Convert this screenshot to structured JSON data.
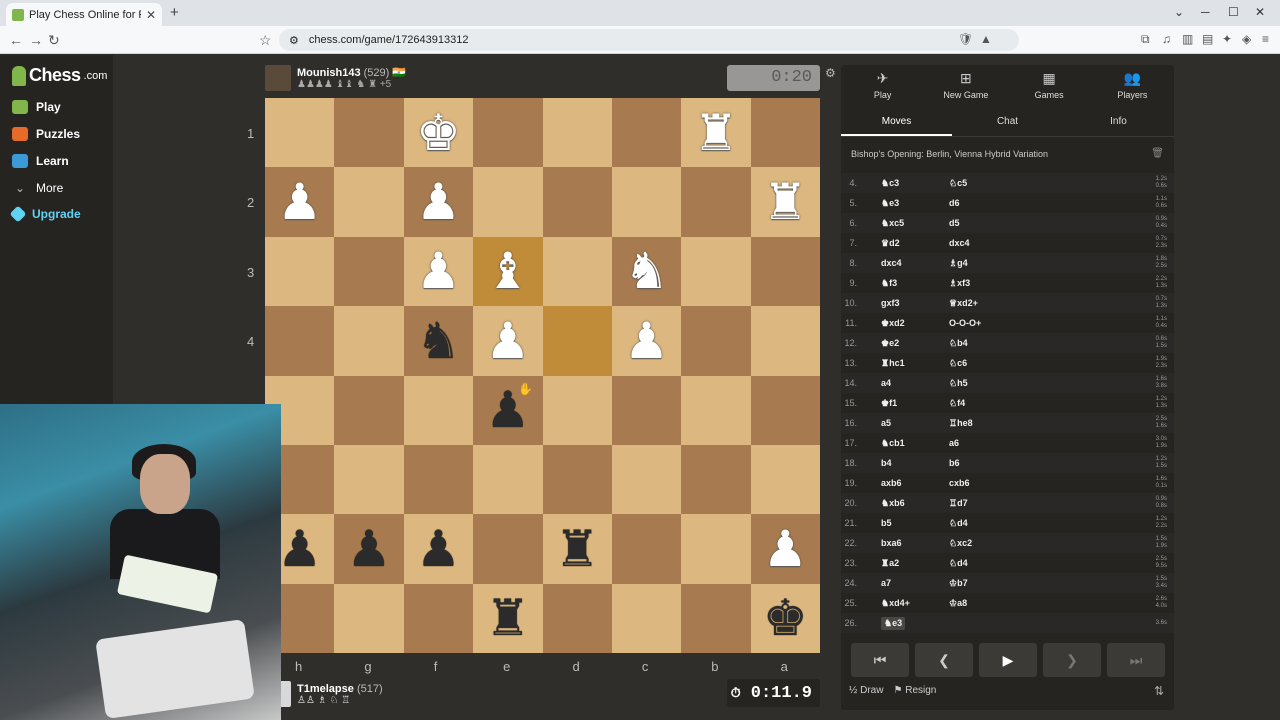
{
  "browser": {
    "tab_title": "Play Chess Online for FREE - ...",
    "tab_close": "✕",
    "new_tab": "+",
    "url": "chess.com/game/172643913312",
    "back": "←",
    "forward": "→",
    "reload": "↻",
    "win_min": "─",
    "win_max": "☐",
    "win_close": "✕",
    "win_down": "⌄"
  },
  "sidebar": {
    "logo": "Chess",
    "logo_suffix": ".com",
    "items": [
      {
        "label": "Play",
        "color": "#81b64c"
      },
      {
        "label": "Puzzles",
        "color": "#e66b28"
      },
      {
        "label": "Learn",
        "color": "#3d9ad8"
      },
      {
        "label": "More",
        "color": "#bbb"
      },
      {
        "label": "Upgrade",
        "color": "#5fd3f3"
      }
    ]
  },
  "top_player": {
    "name": "Mounish143",
    "rating": "(529)",
    "flag": "🇮🇳",
    "captured": "♟♟♟♟ ♝♝ ♞ ♜ +5",
    "clock": "0:20"
  },
  "bottom_player": {
    "name": "T1melapse",
    "rating": "(517)",
    "captured": "♙♙ ♗ ♘ ♖",
    "clock": "0:11.9",
    "clock_icon": "⏱"
  },
  "board": {
    "ranks": [
      "1",
      "2",
      "3",
      "4",
      "5",
      "6",
      "7",
      "8"
    ],
    "files": [
      "h",
      "g",
      "f",
      "e",
      "d",
      "c",
      "b",
      "a"
    ],
    "rows": [
      [
        "",
        "",
        "wK",
        "",
        "",
        "",
        "wR",
        ""
      ],
      [
        "wP",
        "",
        "wP",
        "",
        "",
        "",
        "",
        "wR"
      ],
      [
        "",
        "",
        "wP",
        "wB",
        "",
        "wN",
        "",
        ""
      ],
      [
        "",
        "",
        "bN",
        "wP",
        "",
        "wP",
        "",
        ""
      ],
      [
        "",
        "",
        "",
        "bP",
        "",
        "",
        "",
        ""
      ],
      [
        "",
        "",
        "",
        "",
        "",
        "",
        "",
        ""
      ],
      [
        "bP",
        "bP",
        "bP",
        "",
        "bR",
        "",
        "",
        "wP"
      ],
      [
        "",
        "",
        "",
        "bR",
        "",
        "",
        "",
        "bK"
      ]
    ],
    "highlights": [
      [
        2,
        3
      ],
      [
        3,
        4
      ]
    ],
    "light_color": "#dcb77f",
    "dark_color": "#a77b4f"
  },
  "panel": {
    "tabs": [
      {
        "label": "Play",
        "icon": "✈"
      },
      {
        "label": "New Game",
        "icon": "⊞"
      },
      {
        "label": "Games",
        "icon": "▦"
      },
      {
        "label": "Players",
        "icon": "👥"
      }
    ],
    "subtabs": [
      "Moves",
      "Chat",
      "Info"
    ],
    "opening": "Bishop's Opening: Berlin, Vienna Hybrid Variation",
    "moves": [
      {
        "n": "4.",
        "w": "♞c3",
        "b": "♘c5",
        "t1": "1.2s",
        "t2": "0.6s"
      },
      {
        "n": "5.",
        "w": "♞e3",
        "b": "d6",
        "t1": "1.1s",
        "t2": "0.6s"
      },
      {
        "n": "6.",
        "w": "♞xc5",
        "b": "d5",
        "t1": "0.9s",
        "t2": "0.4s"
      },
      {
        "n": "7.",
        "w": "♛d2",
        "b": "dxc4",
        "t1": "0.7s",
        "t2": "2.3s"
      },
      {
        "n": "8.",
        "w": "dxc4",
        "b": "♗g4",
        "t1": "1.8s",
        "t2": "2.5s"
      },
      {
        "n": "9.",
        "w": "♞f3",
        "b": "♗xf3",
        "t1": "2.2s",
        "t2": "1.3s"
      },
      {
        "n": "10.",
        "w": "gxf3",
        "b": "♕xd2+",
        "t1": "0.7s",
        "t2": "1.3s"
      },
      {
        "n": "11.",
        "w": "♚xd2",
        "b": "O-O-O+",
        "t1": "1.1s",
        "t2": "0.4s"
      },
      {
        "n": "12.",
        "w": "♚e2",
        "b": "♘b4",
        "t1": "0.6s",
        "t2": "1.5s"
      },
      {
        "n": "13.",
        "w": "♜hc1",
        "b": "♘c6",
        "t1": "1.9s",
        "t2": "2.3s"
      },
      {
        "n": "14.",
        "w": "a4",
        "b": "♘h5",
        "t1": "1.6s",
        "t2": "3.8s"
      },
      {
        "n": "15.",
        "w": "♚f1",
        "b": "♘f4",
        "t1": "1.2s",
        "t2": "1.3s"
      },
      {
        "n": "16.",
        "w": "a5",
        "b": "♖he8",
        "t1": "2.5s",
        "t2": "1.6s"
      },
      {
        "n": "17.",
        "w": "♞cb1",
        "b": "a6",
        "t1": "3.0s",
        "t2": "1.9s"
      },
      {
        "n": "18.",
        "w": "b4",
        "b": "b6",
        "t1": "1.2s",
        "t2": "1.5s"
      },
      {
        "n": "19.",
        "w": "axb6",
        "b": "cxb6",
        "t1": "1.6s",
        "t2": "0.1s"
      },
      {
        "n": "20.",
        "w": "♞xb6",
        "b": "♖d7",
        "t1": "0.9s",
        "t2": "0.8s"
      },
      {
        "n": "21.",
        "w": "b5",
        "b": "♘d4",
        "t1": "1.2s",
        "t2": "2.2s"
      },
      {
        "n": "22.",
        "w": "bxa6",
        "b": "♘xc2",
        "t1": "1.5s",
        "t2": "1.9s"
      },
      {
        "n": "23.",
        "w": "♜a2",
        "b": "♘d4",
        "t1": "2.5s",
        "t2": "9.5s"
      },
      {
        "n": "24.",
        "w": "a7",
        "b": "♔b7",
        "t1": "1.5s",
        "t2": "3.4s"
      },
      {
        "n": "25.",
        "w": "♞xd4+",
        "b": "♔a8",
        "t1": "2.6s",
        "t2": "4.0s"
      },
      {
        "n": "26.",
        "w": "♞e3",
        "b": "",
        "t1": "3.6s",
        "t2": ""
      }
    ],
    "controls": [
      "⏮",
      "❮",
      "▶",
      "❯",
      "⏭"
    ],
    "draw": "Draw",
    "draw_icon": "½",
    "resign": "Resign",
    "resign_icon": "⚑",
    "flip_icon": "⇅"
  }
}
